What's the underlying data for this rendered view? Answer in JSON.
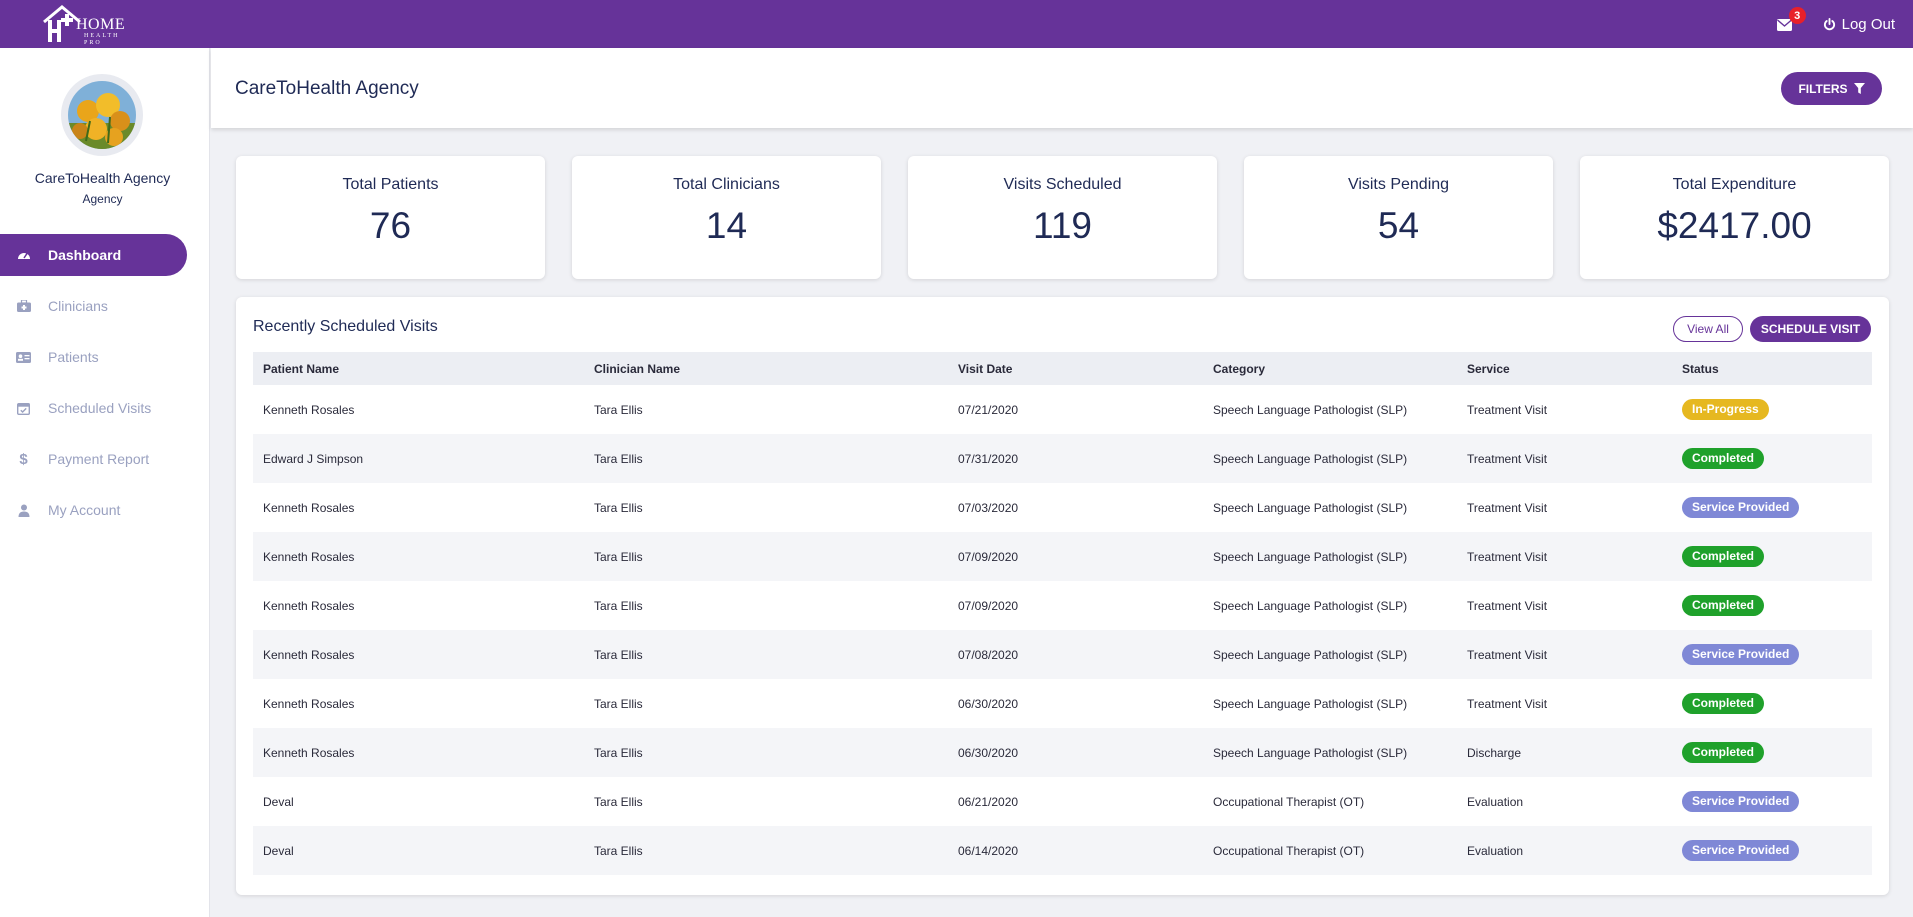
{
  "topbar": {
    "logo_home": "HOME",
    "logo_sub": "HEALTH PRO",
    "notification_count": "3",
    "logout_label": "Log Out"
  },
  "sidebar": {
    "agency_name": "CareToHealth Agency",
    "agency_role": "Agency",
    "items": [
      {
        "label": "Dashboard",
        "icon": "dashboard-icon",
        "active": true
      },
      {
        "label": "Clinicians",
        "icon": "medkit-icon",
        "active": false
      },
      {
        "label": "Patients",
        "icon": "id-card-icon",
        "active": false
      },
      {
        "label": "Scheduled Visits",
        "icon": "calendar-check-icon",
        "active": false
      },
      {
        "label": "Payment Report",
        "icon": "dollar-icon",
        "active": false
      },
      {
        "label": "My Account",
        "icon": "user-icon",
        "active": false
      }
    ]
  },
  "header": {
    "title": "CareToHealth Agency",
    "filters_label": "FILTERS"
  },
  "stats": [
    {
      "label": "Total Patients",
      "value": "76"
    },
    {
      "label": "Total Clinicians",
      "value": "14"
    },
    {
      "label": "Visits Scheduled",
      "value": "119"
    },
    {
      "label": "Visits Pending",
      "value": "54"
    },
    {
      "label": "Total Expenditure",
      "value": "$2417.00"
    }
  ],
  "visits": {
    "title": "Recently Scheduled Visits",
    "view_all_label": "View All",
    "schedule_label": "SCHEDULE VISIT",
    "columns": [
      "Patient Name",
      "Clinician Name",
      "Visit Date",
      "Category",
      "Service",
      "Status"
    ],
    "rows": [
      [
        "Kenneth Rosales",
        "Tara Ellis",
        "07/21/2020",
        "Speech Language Pathologist (SLP)",
        "Treatment Visit",
        "In-Progress"
      ],
      [
        "Edward J Simpson",
        "Tara Ellis",
        "07/31/2020",
        "Speech Language Pathologist (SLP)",
        "Treatment Visit",
        "Completed"
      ],
      [
        "Kenneth Rosales",
        "Tara Ellis",
        "07/03/2020",
        "Speech Language Pathologist (SLP)",
        "Treatment Visit",
        "Service Provided"
      ],
      [
        "Kenneth Rosales",
        "Tara Ellis",
        "07/09/2020",
        "Speech Language Pathologist (SLP)",
        "Treatment Visit",
        "Completed"
      ],
      [
        "Kenneth Rosales",
        "Tara Ellis",
        "07/09/2020",
        "Speech Language Pathologist (SLP)",
        "Treatment Visit",
        "Completed"
      ],
      [
        "Kenneth Rosales",
        "Tara Ellis",
        "07/08/2020",
        "Speech Language Pathologist (SLP)",
        "Treatment Visit",
        "Service Provided"
      ],
      [
        "Kenneth Rosales",
        "Tara Ellis",
        "06/30/2020",
        "Speech Language Pathologist (SLP)",
        "Treatment Visit",
        "Completed"
      ],
      [
        "Kenneth Rosales",
        "Tara Ellis",
        "06/30/2020",
        "Speech Language Pathologist (SLP)",
        "Discharge",
        "Completed"
      ],
      [
        "Deval",
        "Tara Ellis",
        "06/21/2020",
        "Occupational Therapist (OT)",
        "Evaluation",
        "Service Provided"
      ],
      [
        "Deval",
        "Tara Ellis",
        "06/14/2020",
        "Occupational Therapist (OT)",
        "Evaluation",
        "Service Provided"
      ]
    ]
  },
  "colors": {
    "brand": "#663399",
    "in_progress": "#e6b820",
    "completed": "#1fa12b",
    "service_provided": "#7f88d6",
    "notification_badge": "#e8202a"
  }
}
